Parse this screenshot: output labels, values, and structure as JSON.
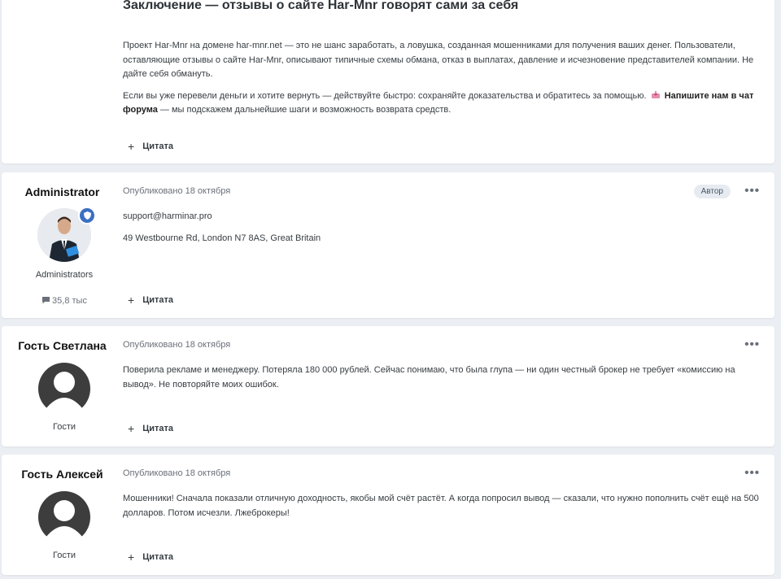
{
  "conclusion": {
    "title": "Заключение — отзывы о сайте Har-Mnr говорят сами за себя",
    "paragraph1": "Проект Har-Mnr на домене har-mnr.net — это не шанс заработать, а ловушка, созданная мошенниками для получения ваших денег. Пользователи, оставляющие отзывы о сайте Har-Mnr, описывают типичные схемы обмана, отказ в выплатах, давление и исчезновение представителей компании. Не дайте себя обмануть.",
    "paragraph2_text": "Если вы уже перевели деньги и хотите вернуть — действуйте быстро: сохраняйте доказательства и обратитесь за помощью.",
    "paragraph2_link": "Напишите нам в чат форума",
    "paragraph2_tail": " — мы подскажем дальнейшие шаги и возможность возврата средств.",
    "quote_label": "Цитата"
  },
  "posts": [
    {
      "author": "Administrator",
      "group": "Administrators",
      "reputation": "35,8 тыс",
      "published": "Опубликовано 18 октября",
      "badge": "Автор",
      "lines": [
        "support@harminar.pro",
        "49 Westbourne Rd, London N7 8AS, Great Britain"
      ],
      "quote_label": "Цитата",
      "menu": "•••"
    },
    {
      "author": "Гость Светлана",
      "group": "Гости",
      "published": "Опубликовано 18 октября",
      "text": "Поверила рекламе и менеджеру. Потеряла 180 000 рублей. Сейчас понимаю, что была глупа — ни один честный брокер не требует «комиссию на вывод». Не повторяйте моих ошибок.",
      "quote_label": "Цитата",
      "menu": "•••"
    },
    {
      "author": "Гость Алексей",
      "group": "Гости",
      "published": "Опубликовано 18 октября",
      "text": "Мошенники! Сначала показали отличную доходность, якобы мой счёт растёт. А когда попросил вывод — сказали, что нужно пополнить счёт ещё на 500 долларов. Потом исчезли. Лжеброкеры!",
      "quote_label": "Цитата",
      "menu": "•••"
    }
  ],
  "icons": {
    "plus": "plus-icon",
    "comment": "comment-icon",
    "shield": "shield-icon",
    "menu": "ellipsis-icon",
    "chat": "chat-icon"
  },
  "colors": {
    "background": "#ebeef2",
    "card": "#ffffff",
    "badge_bg": "#e6ebf2",
    "accent_blue": "#3b6fc2"
  }
}
